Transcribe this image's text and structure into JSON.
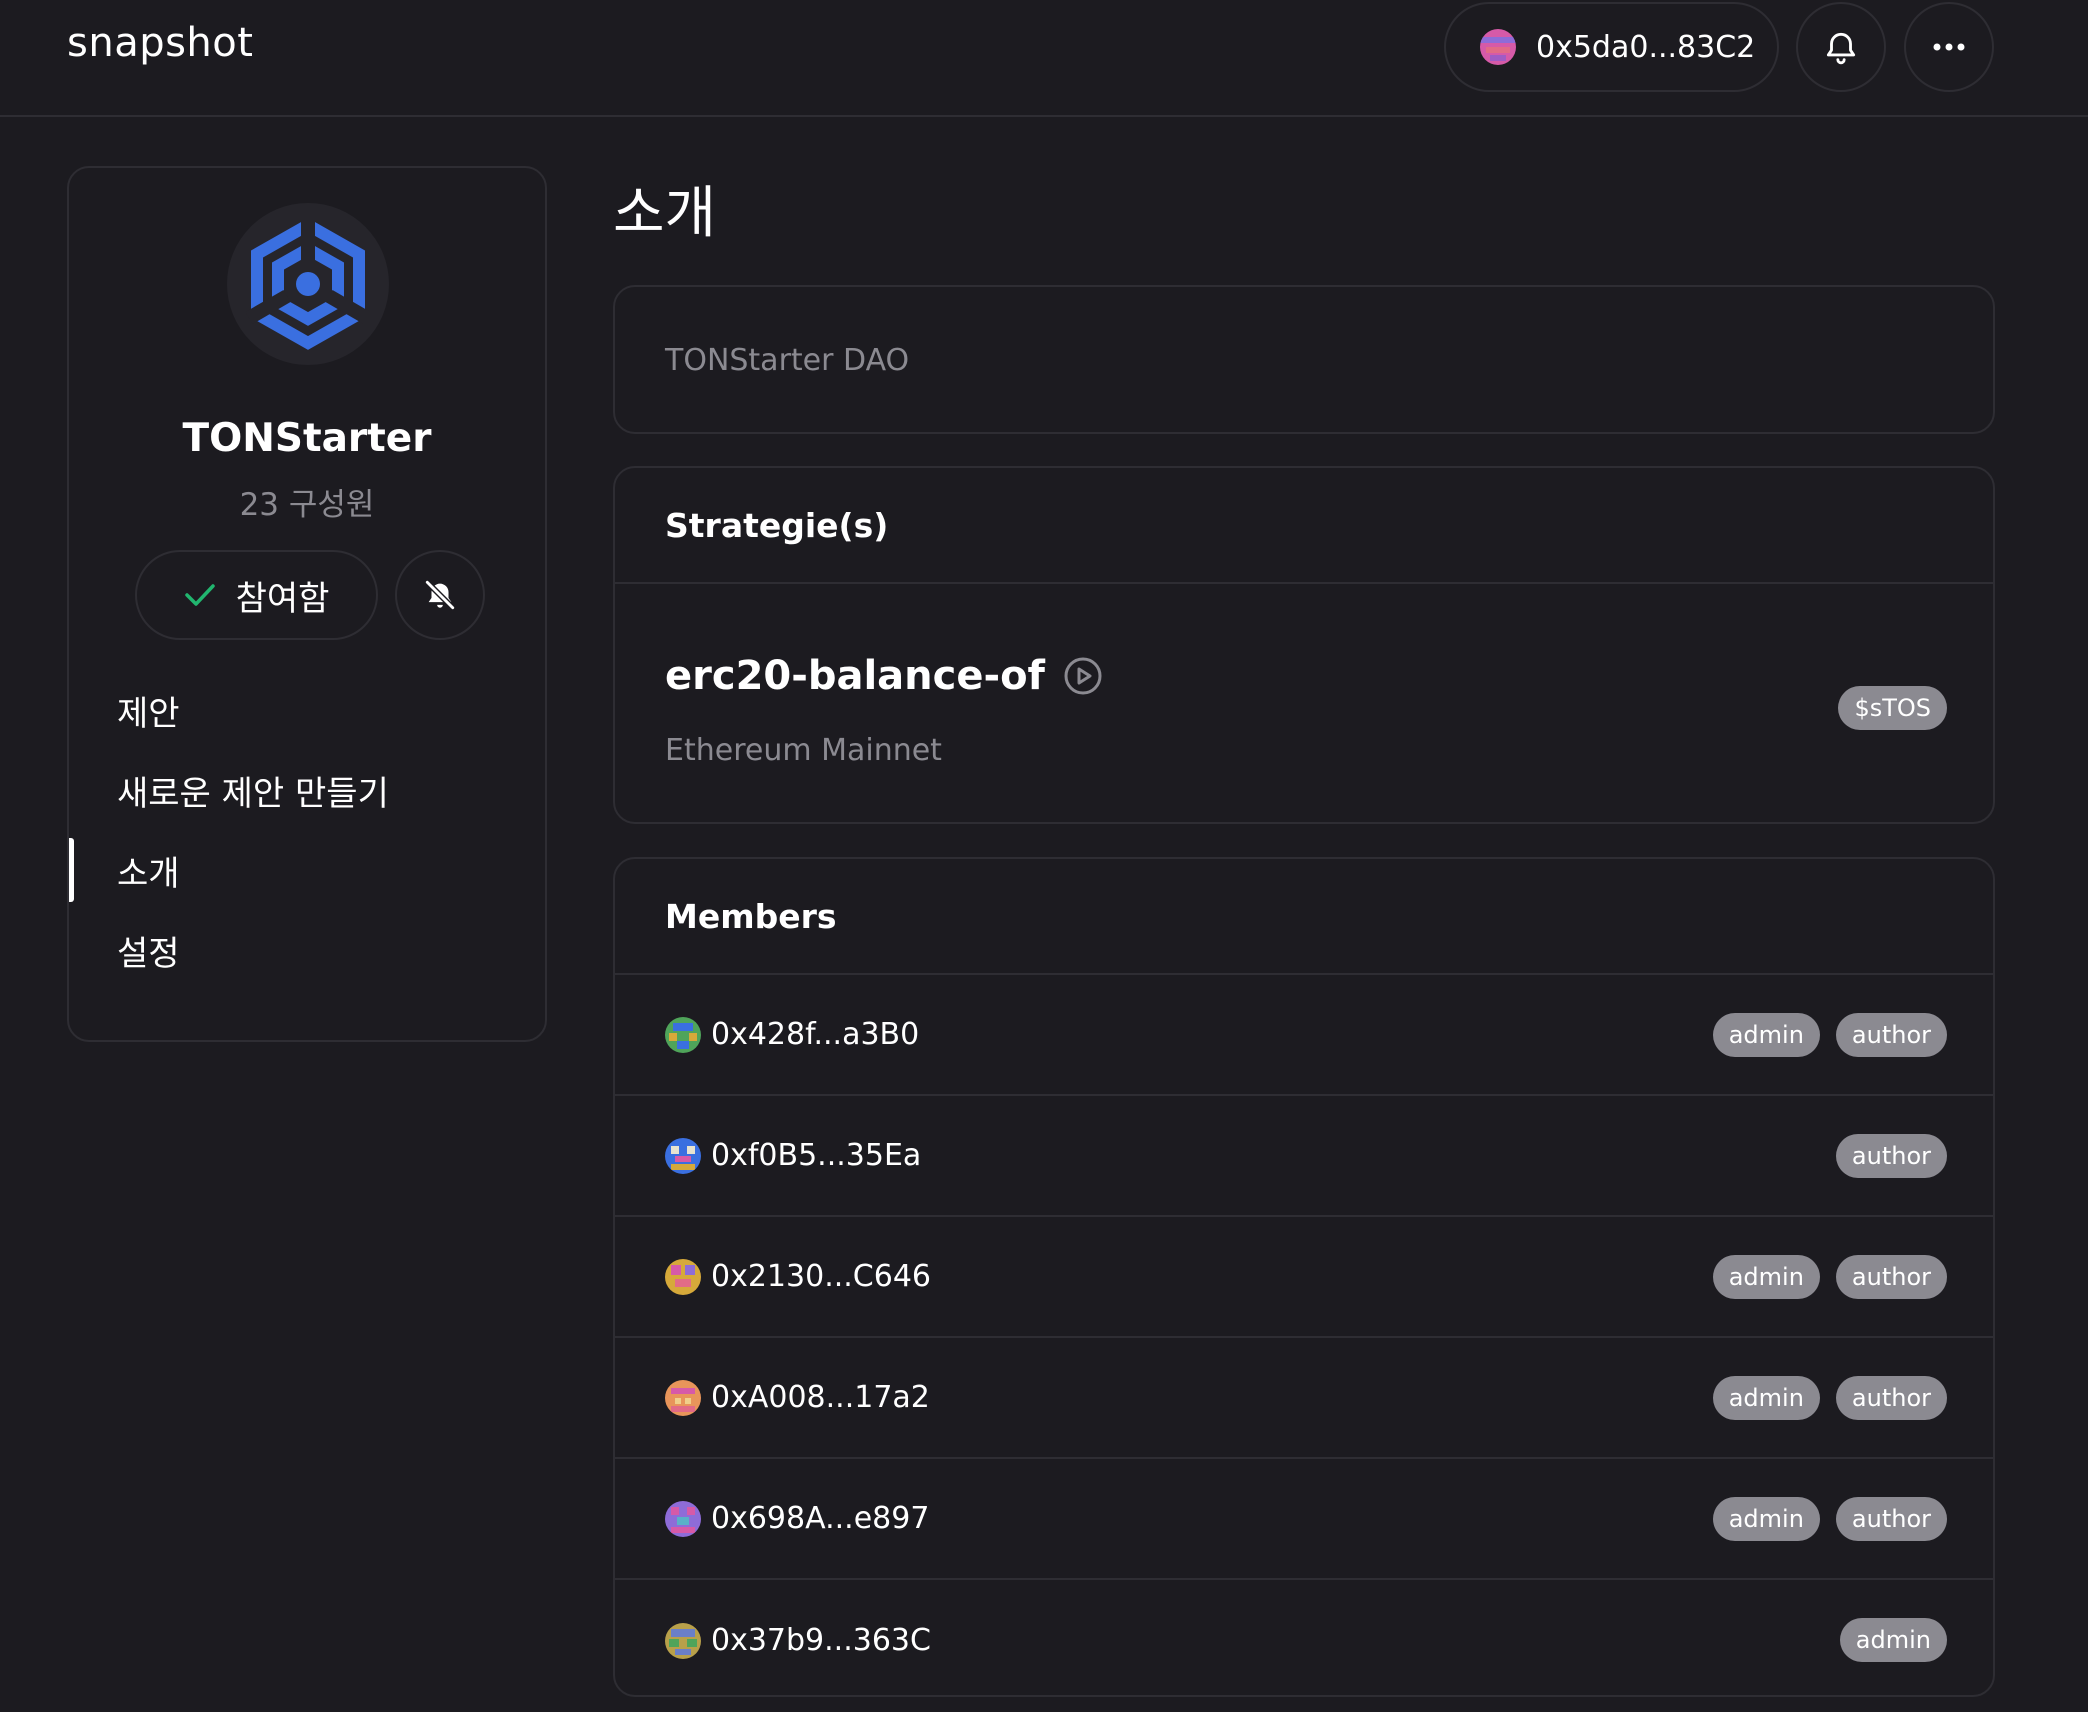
{
  "header": {
    "brand": "snapshot",
    "account": "0x5da0...83C2",
    "icons": {
      "notifications": "bell-icon",
      "more": "ellipsis-icon"
    }
  },
  "sidebar": {
    "space_name": "TONStarter",
    "members_count": "23 구성원",
    "join_label": "참여함",
    "nav": [
      {
        "label": "제안",
        "active": false
      },
      {
        "label": "새로운 제안 만들기",
        "active": false
      },
      {
        "label": "소개",
        "active": true
      },
      {
        "label": "설정",
        "active": false
      }
    ]
  },
  "main": {
    "title": "소개",
    "about": "TONStarter DAO",
    "strategies": {
      "heading": "Strategie(s)",
      "name": "erc20-balance-of",
      "network": "Ethereum Mainnet",
      "symbol": "$sTOS"
    },
    "members": {
      "heading": "Members",
      "rows": [
        {
          "address": "0x428f...a3B0",
          "roles": [
            "admin",
            "author"
          ]
        },
        {
          "address": "0xf0B5...35Ea",
          "roles": [
            "author"
          ]
        },
        {
          "address": "0x2130...C646",
          "roles": [
            "admin",
            "author"
          ]
        },
        {
          "address": "0xA008...17a2",
          "roles": [
            "admin",
            "author"
          ]
        },
        {
          "address": "0x698A...e897",
          "roles": [
            "admin",
            "author"
          ]
        },
        {
          "address": "0x37b9...363C",
          "roles": [
            "admin"
          ]
        }
      ]
    }
  },
  "colors": {
    "background": "#1c1b20",
    "border": "#2e2d33",
    "muted_text": "#8b8a91",
    "logo_blue": "#3a6fe0",
    "check_green": "#21b66f"
  }
}
